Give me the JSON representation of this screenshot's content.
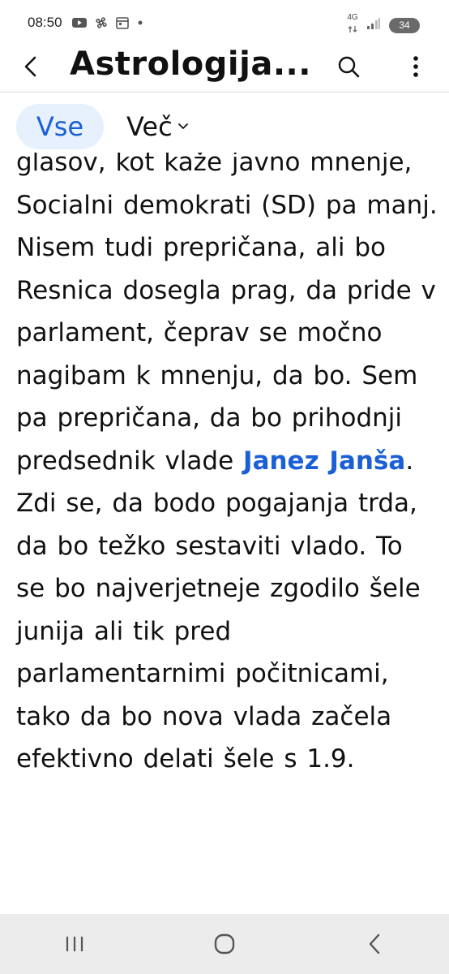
{
  "status_bar": {
    "time": "08:50",
    "network": "4G",
    "battery": "34",
    "icons": [
      "youtube-icon",
      "pinwheel-icon",
      "calendar-icon",
      "dot-icon",
      "network-arrows-icon",
      "signal-icon",
      "battery-icon"
    ]
  },
  "app_bar": {
    "title": "Astrologija...",
    "icons": [
      "back-arrow-icon",
      "search-icon",
      "more-vertical-icon"
    ]
  },
  "tabs": {
    "all_label": "Vse",
    "more_label": "Več",
    "more_icon": "chevron-down-icon"
  },
  "post": {
    "text_before": "glasov, kot kaže javno mnenje, Socialni demokrati (SD) pa manj. Nisem tudi prepričana, ali bo Resnica dosegla prag, da pride v parlament, čeprav se močno nagibam k mnenju, da bo. Sem pa prepričana, da bo prihodnji predsednik vlade ",
    "mention": "Janez Janša",
    "text_after": ". Zdi se, da bodo pogajanja trda, da bo težko sestaviti vlado. To se bo najverjetneje zgodilo šele junija ali tik pred parlamentarnimi počitnicami, tako da bo nova vlada začela efektivno delati šele s 1.9."
  },
  "nav_bar": {
    "icons": [
      "recent-apps-icon",
      "home-icon",
      "back-icon"
    ]
  },
  "colors": {
    "accent": "#1a5fd6",
    "tab_active_bg": "#e7f0fd",
    "nav_bg": "#ececec"
  }
}
